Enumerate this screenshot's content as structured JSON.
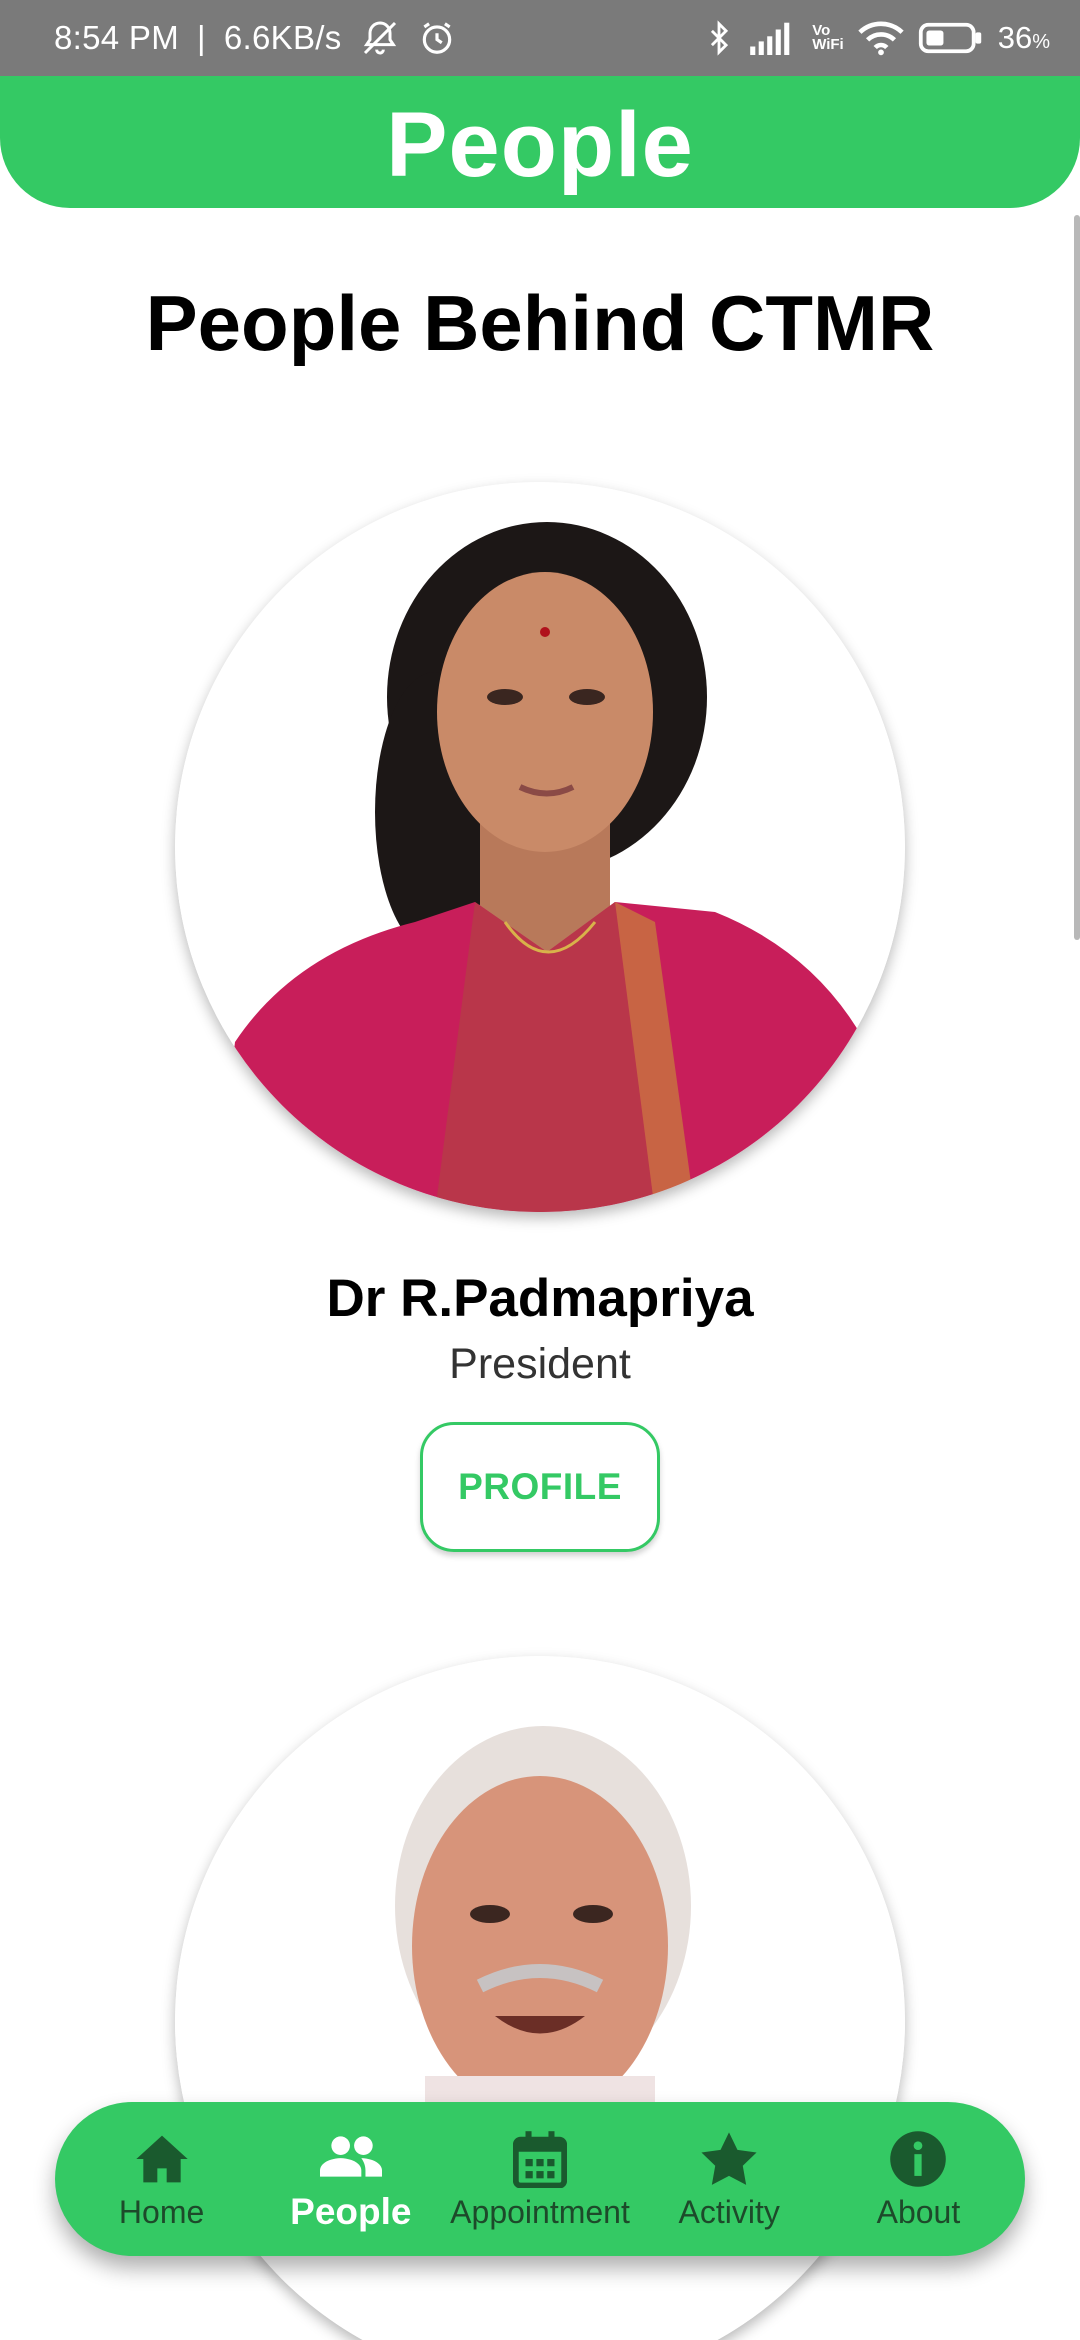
{
  "status_bar": {
    "time": "8:54 PM",
    "separator": "|",
    "speed": "6.6KB/s",
    "vowifi_top": "Vo",
    "vowifi_bottom": "WiFi",
    "battery_percent": "36",
    "battery_unit": "%"
  },
  "app_bar": {
    "title": "People"
  },
  "content": {
    "heading": "People Behind CTMR",
    "people": [
      {
        "name": "Dr R.Padmapriya",
        "role": "President",
        "button_label": "PROFILE"
      }
    ]
  },
  "bottom_nav": {
    "items": [
      {
        "label": "Home",
        "icon": "home-icon",
        "active": false
      },
      {
        "label": "People",
        "icon": "people-icon",
        "active": true
      },
      {
        "label": "Appointment",
        "icon": "calendar-icon",
        "active": false
      },
      {
        "label": "Activity",
        "icon": "star-icon",
        "active": false
      },
      {
        "label": "About",
        "icon": "info-icon",
        "active": false
      }
    ]
  },
  "colors": {
    "brand_green": "#34c964",
    "nav_icon": "#1a5a2e",
    "status_bar": "#7a7a7a"
  }
}
